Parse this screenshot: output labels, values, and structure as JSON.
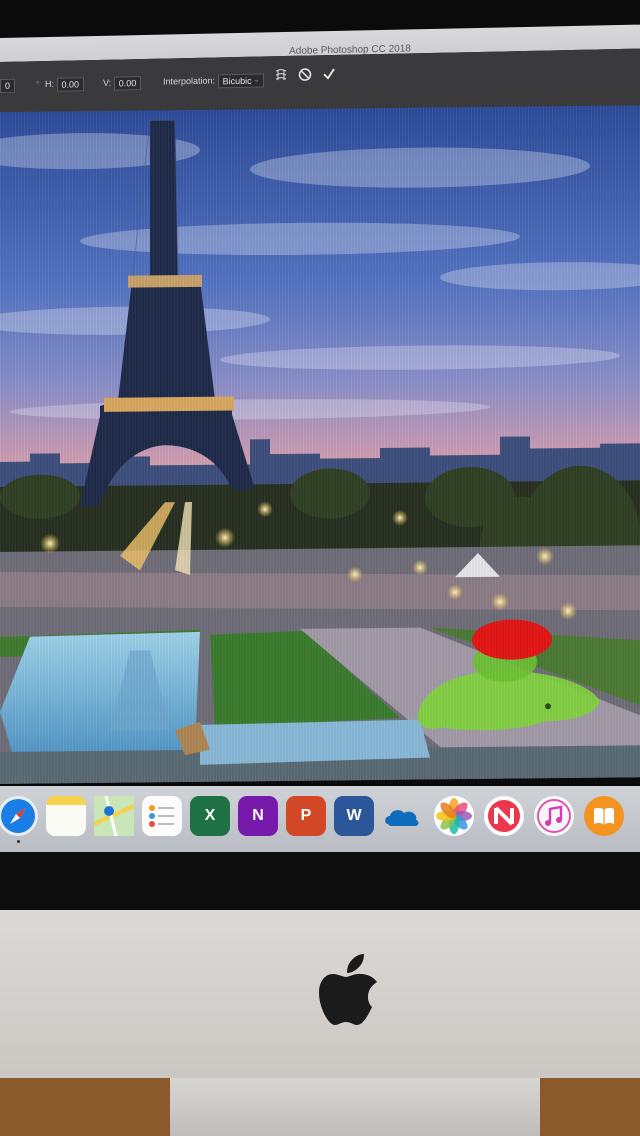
{
  "window": {
    "title": "Adobe Photoshop CC 2018"
  },
  "options_bar": {
    "first_value": "0",
    "h_label": "H:",
    "h_value": "0.00",
    "v_label": "V:",
    "v_value": "0.00",
    "interpolation_label": "Interpolation:",
    "interpolation_value": "Bicubic",
    "icons": [
      "warp-icon",
      "cancel-icon",
      "commit-checkmark-icon"
    ]
  },
  "dock": {
    "apps": [
      {
        "name": "safari-icon",
        "label": ""
      },
      {
        "name": "notes-icon",
        "label": ""
      },
      {
        "name": "maps-icon",
        "label": ""
      },
      {
        "name": "reminders-icon",
        "label": ""
      },
      {
        "name": "excel-icon",
        "label": "X"
      },
      {
        "name": "onenote-icon",
        "label": "N"
      },
      {
        "name": "powerpoint-icon",
        "label": "P"
      },
      {
        "name": "word-icon",
        "label": "W"
      },
      {
        "name": "onedrive-icon",
        "label": ""
      },
      {
        "name": "photos-icon",
        "label": ""
      },
      {
        "name": "news-icon",
        "label": ""
      },
      {
        "name": "itunes-icon",
        "label": ""
      },
      {
        "name": "books-icon",
        "label": ""
      }
    ],
    "colors": {
      "excel": "#1e7145",
      "onenote": "#7719aa",
      "powerpoint": "#d24726",
      "word": "#2b579a"
    }
  }
}
